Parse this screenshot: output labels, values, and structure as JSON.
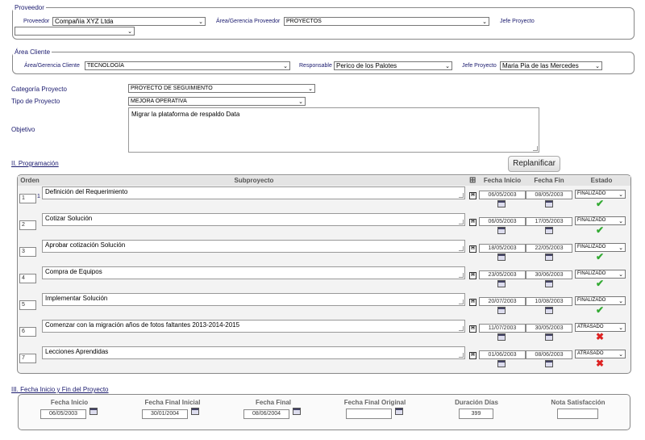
{
  "proveedor_section": {
    "legend": "Proveedor",
    "proveedor_label": "Proveedor",
    "proveedor_value": "Compañía XYZ Ltda",
    "area_label": "Área/Gerencia Proveedor",
    "area_value": "PROYECTOS",
    "jefe_label": "Jefe Proyecto",
    "jefe_value": ""
  },
  "cliente_section": {
    "legend": "Área Cliente",
    "area_label": "Área/Gerencia Cliente",
    "area_value": "TECNOLOGÍA",
    "responsable_label": "Responsable",
    "responsable_value": "Perico de los Palotes",
    "jefe_label": "Jefe Proyecto",
    "jefe_value": "Maria Pia de las Mercedes"
  },
  "project": {
    "categoria_label": "Categoría Proyecto",
    "categoria_value": "PROYECTO DE SEGUIMIENTO",
    "tipo_label": "Tipo de Proyecto",
    "tipo_value": "MEJORA OPERATIVA",
    "objetivo_label": "Objetivo",
    "objetivo_value": "Migrar la plataforma de respaldo Data"
  },
  "programacion": {
    "title": "II. Programación",
    "replanificar_label": "Replanificar",
    "headers": {
      "orden": "Orden",
      "subproyecto": "Subproyecto",
      "fecha_inicio": "Fecha Inicio",
      "fecha_fin": "Fecha Fin",
      "estado": "Estado"
    },
    "hidden_button_label": "H",
    "rows": [
      {
        "orden": "1",
        "extra": "1",
        "name": "Definición del Requerimiento",
        "inicio": "06/05/2003",
        "fin": "08/05/2003",
        "estado": "FINALIZADO",
        "ok": true
      },
      {
        "orden": "2",
        "extra": "",
        "name": "Cotizar Solución",
        "inicio": "06/05/2003",
        "fin": "17/05/2003",
        "estado": "FINALIZADO",
        "ok": true
      },
      {
        "orden": "3",
        "extra": "",
        "name": "Aprobar cotización Solución",
        "inicio": "18/05/2003",
        "fin": "22/05/2003",
        "estado": "FINALIZADO",
        "ok": true
      },
      {
        "orden": "4",
        "extra": "",
        "name": "Compra de Equipos",
        "inicio": "23/05/2003",
        "fin": "30/06/2003",
        "estado": "FINALIZADO",
        "ok": true
      },
      {
        "orden": "5",
        "extra": "",
        "name": "Implementar Solución",
        "inicio": "20/07/2003",
        "fin": "10/08/2003",
        "estado": "FINALIZADO",
        "ok": true
      },
      {
        "orden": "6",
        "extra": "",
        "name": "Comenzar con la migración años de fotos faltantes 2013-2014-2015",
        "inicio": "11/07/2003",
        "fin": "30/05/2003",
        "estado": "ATRASADO",
        "ok": false
      },
      {
        "orden": "7",
        "extra": "",
        "name": "Lecciones Aprendidas",
        "inicio": "01/06/2003",
        "fin": "08/06/2003",
        "estado": "ATRASADO",
        "ok": false
      }
    ]
  },
  "fechas": {
    "title": "III. Fecha Inicio y Fin del Proyecto",
    "fecha_inicio_label": "Fecha Inicio",
    "fecha_inicio_value": "06/05/2003",
    "fecha_final_inicial_label": "Fecha Final Inicial",
    "fecha_final_inicial_value": "30/01/2004",
    "fecha_final_label": "Fecha Final",
    "fecha_final_value": "08/06/2004",
    "fecha_final_original_label": "Fecha Final Original",
    "fecha_final_original_value": "",
    "duracion_label": "Duración Días",
    "duracion_value": "399",
    "nota_label": "Nota Satisfacción",
    "nota_value": ""
  }
}
